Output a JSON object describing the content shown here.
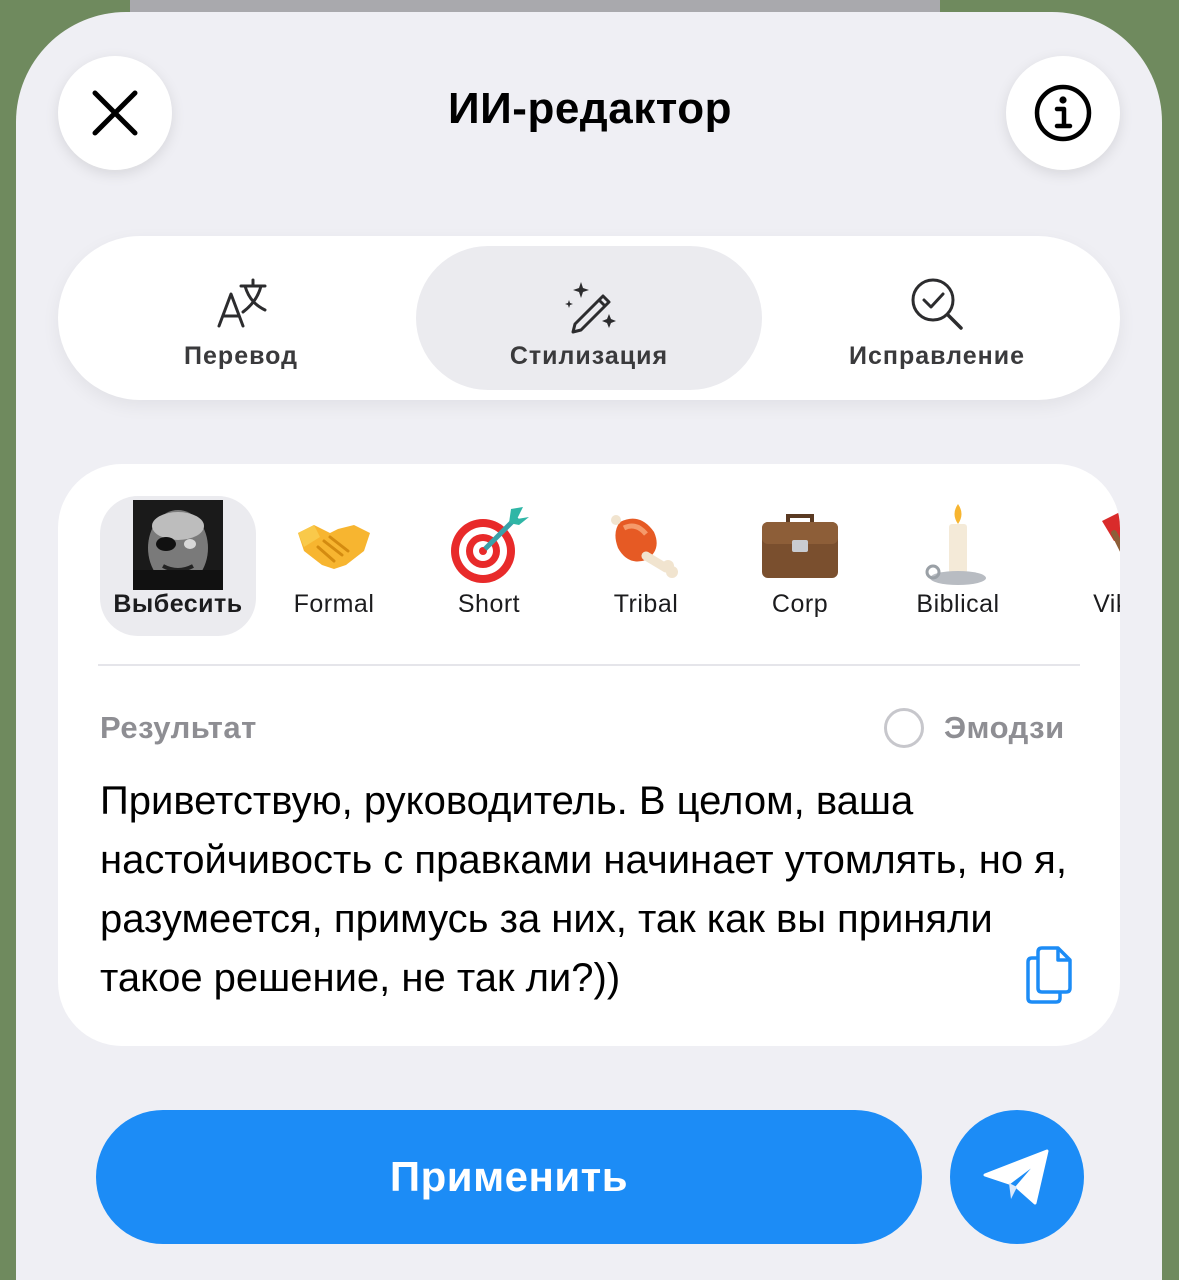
{
  "header": {
    "title": "ИИ-редактор",
    "close_icon": "close-icon",
    "info_icon": "info-icon"
  },
  "tabs": [
    {
      "label": "Перевод",
      "icon": "translate-icon",
      "active": false
    },
    {
      "label": "Стилизация",
      "icon": "magic-wand-icon",
      "active": true
    },
    {
      "label": "Исправление",
      "icon": "search-check-icon",
      "active": false
    }
  ],
  "styles": [
    {
      "label": "Выбесить",
      "icon": "face-avatar",
      "selected": true
    },
    {
      "label": "Formal",
      "icon": "handshake-icon",
      "selected": false
    },
    {
      "label": "Short",
      "icon": "dart-target-icon",
      "selected": false
    },
    {
      "label": "Tribal",
      "icon": "meat-icon",
      "selected": false
    },
    {
      "label": "Corp",
      "icon": "briefcase-icon",
      "selected": false
    },
    {
      "label": "Biblical",
      "icon": "candle-icon",
      "selected": false
    },
    {
      "label": "Viki",
      "icon": "axe-icon",
      "selected": false
    }
  ],
  "result": {
    "label": "Результат",
    "emoji_toggle_label": "Эмодзи",
    "emoji_enabled": false,
    "text": "Приветствую, руководитель. В целом, ваша настойчивость с правками начинает утомлять, но я, разумеется, примусь за них, так как вы приняли такое решение, не так ли?))"
  },
  "actions": {
    "apply_label": "Применить",
    "send_icon": "send-icon"
  },
  "colors": {
    "accent": "#1c8cf6",
    "sheet_background": "#efeff4",
    "card_background": "#ffffff",
    "secondary_text": "#8e8e93"
  }
}
